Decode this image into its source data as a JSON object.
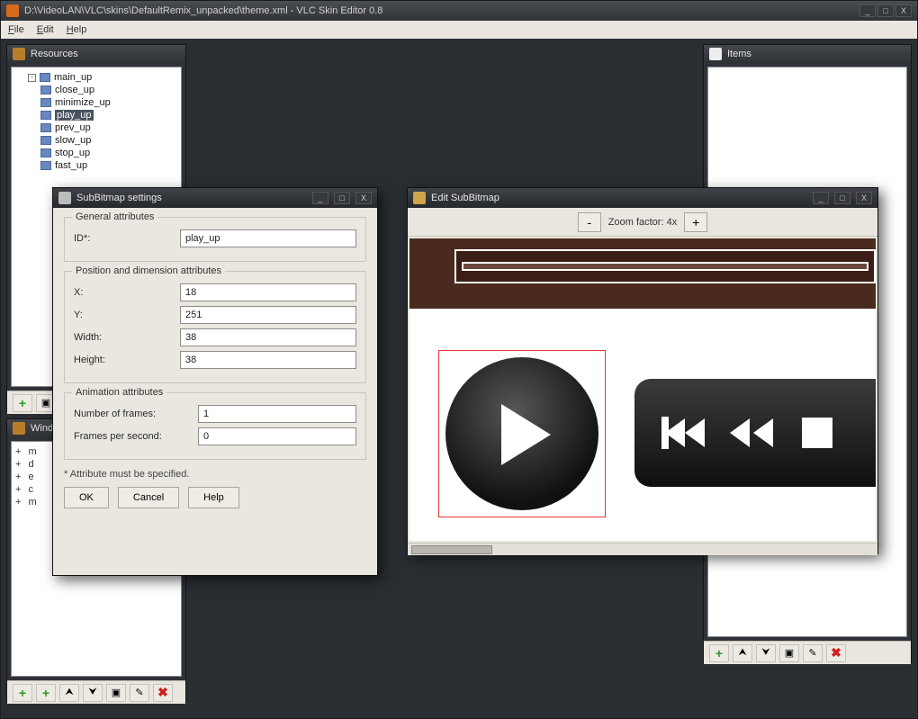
{
  "app": {
    "title": "D:\\VideoLAN\\VLC\\skins\\DefaultRemix_unpacked\\theme.xml - VLC Skin Editor 0.8",
    "menu": {
      "file": "File",
      "edit": "Edit",
      "help": "Help"
    }
  },
  "resources": {
    "title": "Resources",
    "items": {
      "parent": "main_up",
      "children": [
        "close_up",
        "minimize_up",
        "play_up",
        "prev_up",
        "slow_up",
        "stop_up",
        "fast_up"
      ],
      "selected": "play_up"
    }
  },
  "items_panel": {
    "title": "Items"
  },
  "windows_panel": {
    "title": "Windows",
    "rows": [
      "m",
      "d",
      "e",
      "c",
      "m"
    ]
  },
  "subbitmap": {
    "title": "SubBitmap settings",
    "groups": {
      "general": "General attributes",
      "posdim": "Position and dimension attributes",
      "anim": "Animation attributes"
    },
    "labels": {
      "id": "ID*:",
      "x": "X:",
      "y": "Y:",
      "width": "Width:",
      "height": "Height:",
      "nframes": "Number of frames:",
      "fps": "Frames per second:"
    },
    "values": {
      "id": "play_up",
      "x": "18",
      "y": "251",
      "width": "38",
      "height": "38",
      "nframes": "1",
      "fps": "0"
    },
    "note": "* Attribute must be specified.",
    "buttons": {
      "ok": "OK",
      "cancel": "Cancel",
      "help": "Help"
    }
  },
  "editsub": {
    "title": "Edit SubBitmap",
    "zoom_label": "Zoom factor: 4x",
    "zoom_out": "-",
    "zoom_in": "+"
  },
  "winbtns": {
    "min": "_",
    "max": "□",
    "close": "X"
  }
}
